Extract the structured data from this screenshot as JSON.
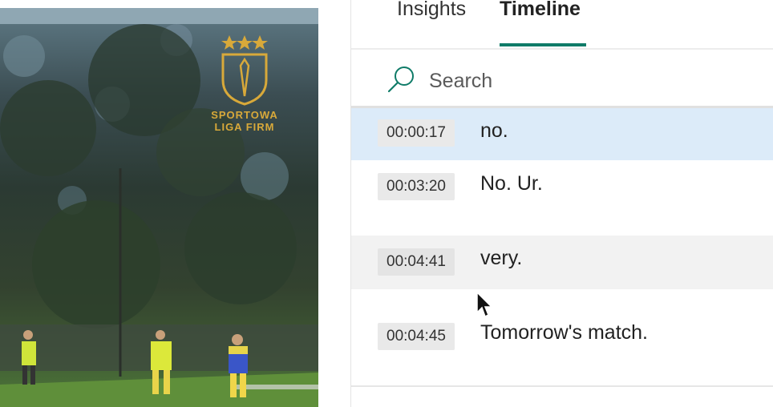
{
  "video": {
    "logo_line1": "SPORTOWA",
    "logo_line2": "LIGA FIRM",
    "logo_color": "#d8a93a"
  },
  "tabs": [
    {
      "label": "Insights",
      "active": false
    },
    {
      "label": "Timeline",
      "active": true
    }
  ],
  "accent_color": "#0f7b68",
  "search": {
    "placeholder": "Search",
    "value": ""
  },
  "transcript": [
    {
      "time": "00:00:17",
      "text": "no.",
      "selected": true
    },
    {
      "time": "00:03:20",
      "text": "No. Ur."
    },
    {
      "time": "00:04:41",
      "text": "very.",
      "hovered": true
    },
    {
      "time": "00:04:45",
      "text": "Tomorrow's match."
    }
  ]
}
